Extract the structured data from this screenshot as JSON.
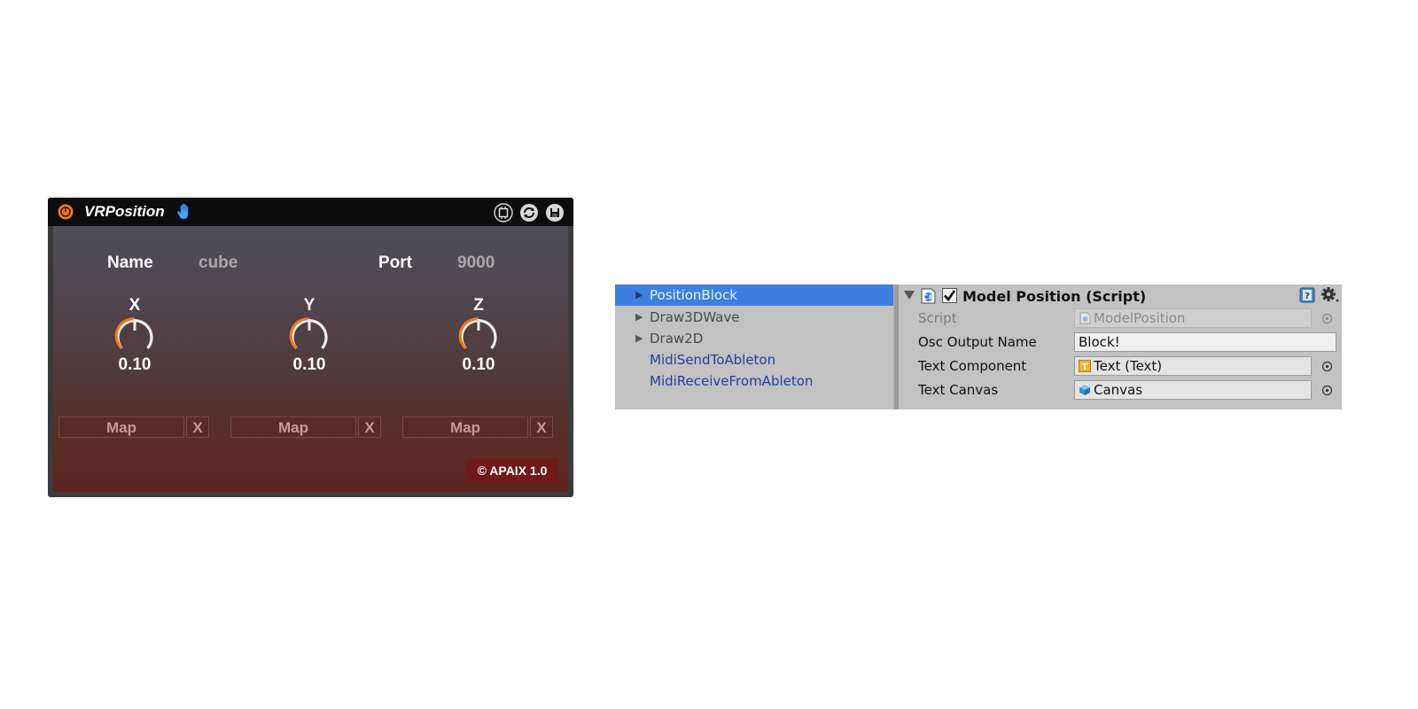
{
  "device": {
    "title": "VRPosition",
    "name_label": "Name",
    "name_value": "cube",
    "port_label": "Port",
    "port_value": "9000",
    "knobs": [
      {
        "axis": "X",
        "value": "0.10",
        "level": 0.1
      },
      {
        "axis": "Y",
        "value": "0.10",
        "level": 0.1
      },
      {
        "axis": "Z",
        "value": "0.10",
        "level": 0.1
      }
    ],
    "map_buttons": [
      {
        "label": "Map",
        "clear": "X"
      },
      {
        "label": "Map",
        "clear": "X"
      },
      {
        "label": "Map",
        "clear": "X"
      }
    ],
    "copyright": "© APAIX 1.0",
    "accent_color": "#f07a1e",
    "icons": {
      "power": "power-icon",
      "hand": "hand-icon",
      "toolbar": [
        "hot-swap-icon",
        "refresh-icon",
        "save-icon"
      ]
    }
  },
  "hierarchy": {
    "items": [
      {
        "label": "PositionBlock",
        "expandable": true,
        "selected": true
      },
      {
        "label": "Draw3DWave",
        "expandable": true,
        "selected": false
      },
      {
        "label": "Draw2D",
        "expandable": true,
        "selected": false
      },
      {
        "label": "MidiSendToAbleton",
        "expandable": false,
        "selected": false
      },
      {
        "label": "MidiReceiveFromAbleton",
        "expandable": false,
        "selected": false
      }
    ],
    "selected_color": "#3d80e0",
    "prefab_text_color": "#1f3fa0"
  },
  "inspector": {
    "component_title": "Model Position (Script)",
    "enabled": true,
    "fields": [
      {
        "label": "Script",
        "value": "ModelPosition",
        "icon": "script-asset-icon"
      },
      {
        "label": "Osc Output Name",
        "value": "Block!"
      },
      {
        "label": "Text Component",
        "value": "Text (Text)",
        "icon": "text-component-icon"
      },
      {
        "label": "Text Canvas",
        "value": "Canvas",
        "icon": "gameobject-cube-icon"
      }
    ]
  }
}
